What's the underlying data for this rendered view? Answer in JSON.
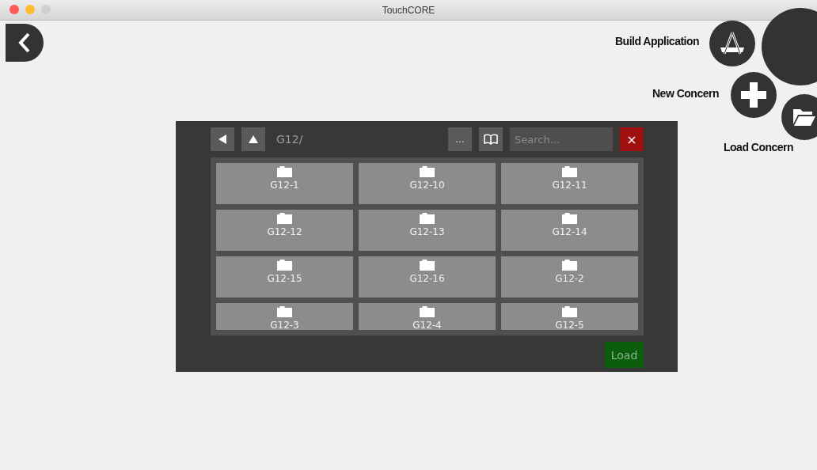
{
  "window": {
    "title": "TouchCORE"
  },
  "actions": [
    {
      "kind": "build",
      "label": "Build Application"
    },
    {
      "kind": "new",
      "label": "New Concern"
    },
    {
      "kind": "load",
      "label": "Load Concern"
    }
  ],
  "browser": {
    "path": "G12/",
    "more_button": "...",
    "search": {
      "placeholder": "Search..."
    },
    "close_button": "×",
    "folders": [
      {
        "name": "G12-1"
      },
      {
        "name": "G12-10"
      },
      {
        "name": "G12-11"
      },
      {
        "name": "G12-12"
      },
      {
        "name": "G12-13"
      },
      {
        "name": "G12-14"
      },
      {
        "name": "G12-15"
      },
      {
        "name": "G12-16"
      },
      {
        "name": "G12-2"
      },
      {
        "name": "G12-3"
      },
      {
        "name": "G12-4"
      },
      {
        "name": "G12-5"
      }
    ],
    "load_button": "Load"
  }
}
